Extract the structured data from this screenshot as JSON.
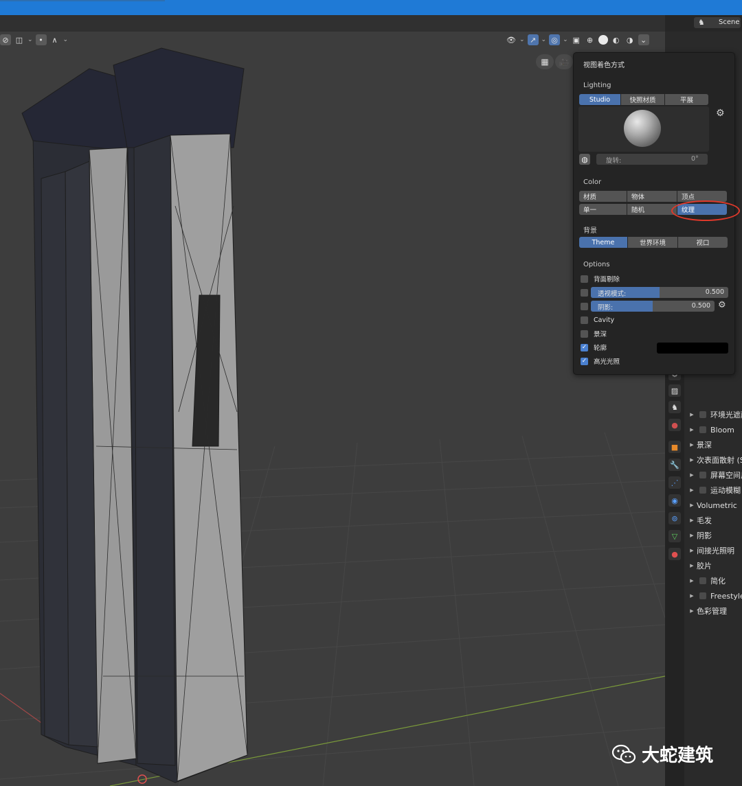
{
  "header": {
    "scene_label": "Scene"
  },
  "shading_popover": {
    "title": "视图着色方式",
    "lighting": {
      "section": "Lighting",
      "options": [
        "Studio",
        "快照材质",
        "平展"
      ],
      "selected": "Studio",
      "rotation_label": "旋转:",
      "rotation_value": "0°"
    },
    "color": {
      "section": "Color",
      "row1": [
        "材质",
        "物体",
        "顶点"
      ],
      "row2": [
        "单一",
        "随机",
        "纹理"
      ],
      "selected": "纹理"
    },
    "background": {
      "section": "背景",
      "options": [
        "Theme",
        "世界环境",
        "视口"
      ],
      "selected": "Theme"
    },
    "options": {
      "section": "Options",
      "backface_culling": "背面剔除",
      "xray_label": "透视模式:",
      "xray_value": "0.500",
      "xray_fraction": 0.5,
      "shadow_label": "阴影:",
      "shadow_value": "0.500",
      "shadow_fraction": 0.5,
      "cavity": "Cavity",
      "dof": "景深",
      "outline": "轮廓",
      "outline_checked": true,
      "specular": "高光光照",
      "specular_checked": true
    }
  },
  "properties": {
    "render_sections": [
      {
        "label": "环境光遮蔽",
        "checkbox": true
      },
      {
        "label": "Bloom",
        "checkbox": true
      },
      {
        "label": "景深",
        "checkbox": false
      },
      {
        "label": "次表面散射 (S",
        "checkbox": false
      },
      {
        "label": "屏幕空间反",
        "checkbox": true
      },
      {
        "label": "运动模糊",
        "checkbox": true
      },
      {
        "label": "Volumetric",
        "checkbox": false
      },
      {
        "label": "毛发",
        "checkbox": false
      },
      {
        "label": "阴影",
        "checkbox": false
      },
      {
        "label": "间接光照明",
        "checkbox": false
      },
      {
        "label": "胶片",
        "checkbox": false
      },
      {
        "label": "简化",
        "checkbox": true
      },
      {
        "label": "Freestyle",
        "checkbox": true
      },
      {
        "label": "色彩管理",
        "checkbox": false
      }
    ]
  },
  "watermark": {
    "text": "大蛇建筑"
  },
  "colors": {
    "accent": "#4a72ad",
    "highlight_ellipse": "#e0392b",
    "title_bar": "#1f7ad6"
  }
}
